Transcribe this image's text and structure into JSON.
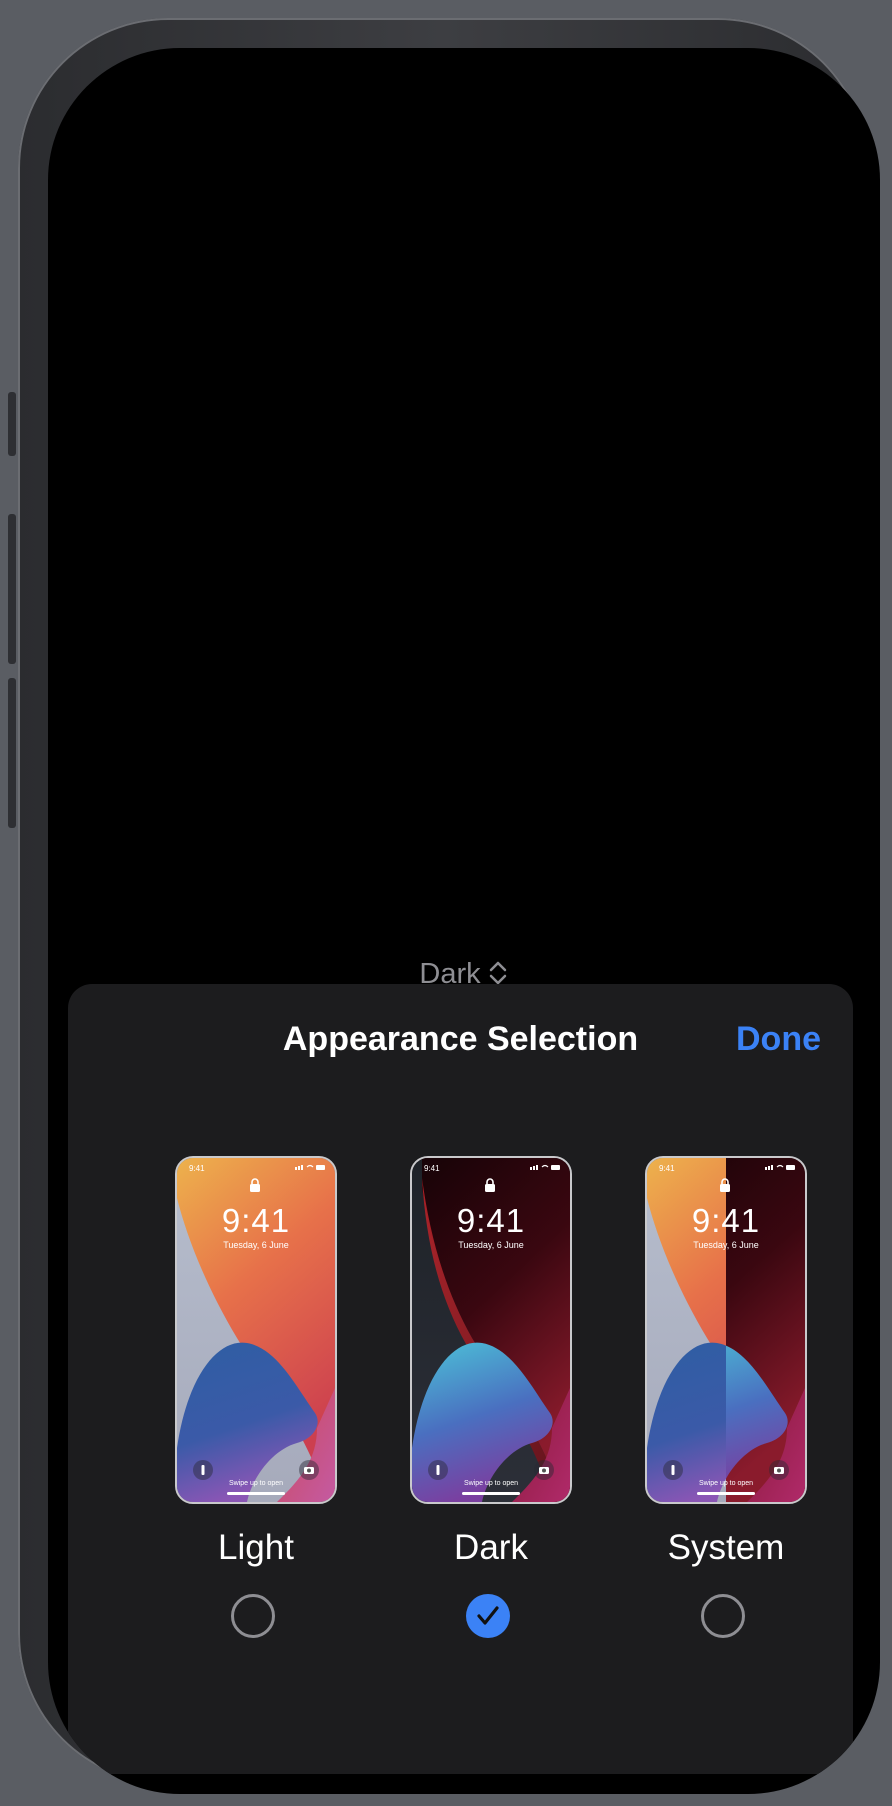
{
  "device": {
    "frame_color": "#2b2c2f",
    "screen_color": "#000000"
  },
  "picker": {
    "value": "Dark",
    "icon": "chevron-up-down-icon"
  },
  "sheet": {
    "title": "Appearance Selection",
    "done_label": "Done",
    "accent_color": "#3b82f6",
    "background": "#1c1c1e"
  },
  "options": [
    {
      "label": "Light",
      "selected": false,
      "time": "9:41",
      "date": "Tuesday, 6 June",
      "status_time": "9:41",
      "swipe_text": "Swipe up to open"
    },
    {
      "label": "Dark",
      "selected": true,
      "time": "9:41",
      "date": "Tuesday, 6 June",
      "status_time": "9:41",
      "swipe_text": "Swipe up to open"
    },
    {
      "label": "System",
      "selected": false,
      "time": "9:41",
      "date": "Tuesday, 6 June",
      "status_time": "9:41",
      "swipe_text": "Swipe up to open"
    }
  ]
}
